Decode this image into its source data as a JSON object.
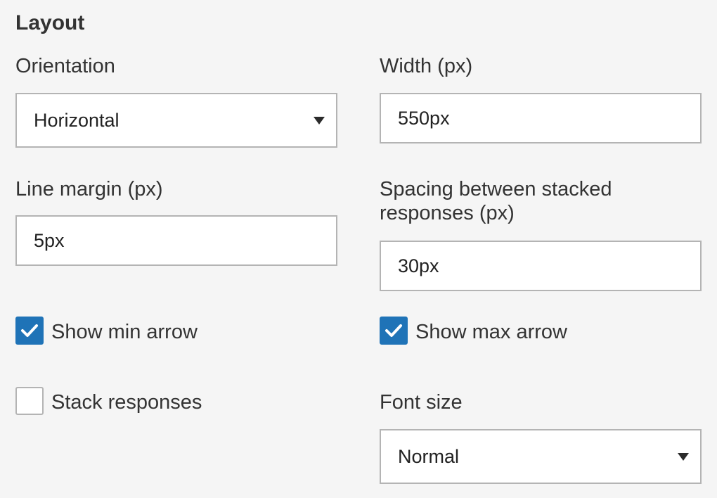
{
  "section": {
    "title": "Layout"
  },
  "orientation": {
    "label": "Orientation",
    "value": "Horizontal"
  },
  "width": {
    "label": "Width (px)",
    "value": "550px"
  },
  "line_margin": {
    "label": "Line margin (px)",
    "value": "5px"
  },
  "spacing": {
    "label_line1": "Spacing between stacked",
    "label_line2": "responses (px)",
    "value": "30px"
  },
  "show_min_arrow": {
    "label": "Show min arrow",
    "checked": true
  },
  "show_max_arrow": {
    "label": "Show max arrow",
    "checked": true
  },
  "stack_responses": {
    "label": "Stack responses",
    "checked": false
  },
  "font_size": {
    "label": "Font size",
    "value": "Normal"
  },
  "colors": {
    "accent": "#1f73b7",
    "border": "#b4b4b4",
    "background": "#f5f5f5"
  }
}
